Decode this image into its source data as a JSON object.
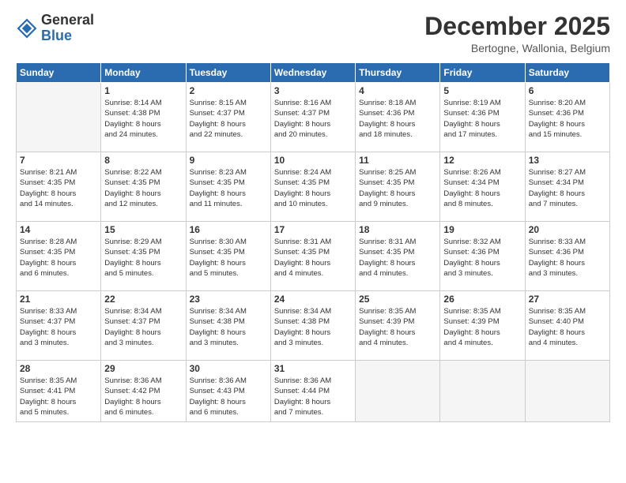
{
  "logo": {
    "general": "General",
    "blue": "Blue"
  },
  "title": "December 2025",
  "location": "Bertogne, Wallonia, Belgium",
  "days_of_week": [
    "Sunday",
    "Monday",
    "Tuesday",
    "Wednesday",
    "Thursday",
    "Friday",
    "Saturday"
  ],
  "weeks": [
    [
      {
        "day": "",
        "detail": ""
      },
      {
        "day": "1",
        "detail": "Sunrise: 8:14 AM\nSunset: 4:38 PM\nDaylight: 8 hours\nand 24 minutes."
      },
      {
        "day": "2",
        "detail": "Sunrise: 8:15 AM\nSunset: 4:37 PM\nDaylight: 8 hours\nand 22 minutes."
      },
      {
        "day": "3",
        "detail": "Sunrise: 8:16 AM\nSunset: 4:37 PM\nDaylight: 8 hours\nand 20 minutes."
      },
      {
        "day": "4",
        "detail": "Sunrise: 8:18 AM\nSunset: 4:36 PM\nDaylight: 8 hours\nand 18 minutes."
      },
      {
        "day": "5",
        "detail": "Sunrise: 8:19 AM\nSunset: 4:36 PM\nDaylight: 8 hours\nand 17 minutes."
      },
      {
        "day": "6",
        "detail": "Sunrise: 8:20 AM\nSunset: 4:36 PM\nDaylight: 8 hours\nand 15 minutes."
      }
    ],
    [
      {
        "day": "7",
        "detail": "Sunrise: 8:21 AM\nSunset: 4:35 PM\nDaylight: 8 hours\nand 14 minutes."
      },
      {
        "day": "8",
        "detail": "Sunrise: 8:22 AM\nSunset: 4:35 PM\nDaylight: 8 hours\nand 12 minutes."
      },
      {
        "day": "9",
        "detail": "Sunrise: 8:23 AM\nSunset: 4:35 PM\nDaylight: 8 hours\nand 11 minutes."
      },
      {
        "day": "10",
        "detail": "Sunrise: 8:24 AM\nSunset: 4:35 PM\nDaylight: 8 hours\nand 10 minutes."
      },
      {
        "day": "11",
        "detail": "Sunrise: 8:25 AM\nSunset: 4:35 PM\nDaylight: 8 hours\nand 9 minutes."
      },
      {
        "day": "12",
        "detail": "Sunrise: 8:26 AM\nSunset: 4:34 PM\nDaylight: 8 hours\nand 8 minutes."
      },
      {
        "day": "13",
        "detail": "Sunrise: 8:27 AM\nSunset: 4:34 PM\nDaylight: 8 hours\nand 7 minutes."
      }
    ],
    [
      {
        "day": "14",
        "detail": "Sunrise: 8:28 AM\nSunset: 4:35 PM\nDaylight: 8 hours\nand 6 minutes."
      },
      {
        "day": "15",
        "detail": "Sunrise: 8:29 AM\nSunset: 4:35 PM\nDaylight: 8 hours\nand 5 minutes."
      },
      {
        "day": "16",
        "detail": "Sunrise: 8:30 AM\nSunset: 4:35 PM\nDaylight: 8 hours\nand 5 minutes."
      },
      {
        "day": "17",
        "detail": "Sunrise: 8:31 AM\nSunset: 4:35 PM\nDaylight: 8 hours\nand 4 minutes."
      },
      {
        "day": "18",
        "detail": "Sunrise: 8:31 AM\nSunset: 4:35 PM\nDaylight: 8 hours\nand 4 minutes."
      },
      {
        "day": "19",
        "detail": "Sunrise: 8:32 AM\nSunset: 4:36 PM\nDaylight: 8 hours\nand 3 minutes."
      },
      {
        "day": "20",
        "detail": "Sunrise: 8:33 AM\nSunset: 4:36 PM\nDaylight: 8 hours\nand 3 minutes."
      }
    ],
    [
      {
        "day": "21",
        "detail": "Sunrise: 8:33 AM\nSunset: 4:37 PM\nDaylight: 8 hours\nand 3 minutes."
      },
      {
        "day": "22",
        "detail": "Sunrise: 8:34 AM\nSunset: 4:37 PM\nDaylight: 8 hours\nand 3 minutes."
      },
      {
        "day": "23",
        "detail": "Sunrise: 8:34 AM\nSunset: 4:38 PM\nDaylight: 8 hours\nand 3 minutes."
      },
      {
        "day": "24",
        "detail": "Sunrise: 8:34 AM\nSunset: 4:38 PM\nDaylight: 8 hours\nand 3 minutes."
      },
      {
        "day": "25",
        "detail": "Sunrise: 8:35 AM\nSunset: 4:39 PM\nDaylight: 8 hours\nand 4 minutes."
      },
      {
        "day": "26",
        "detail": "Sunrise: 8:35 AM\nSunset: 4:39 PM\nDaylight: 8 hours\nand 4 minutes."
      },
      {
        "day": "27",
        "detail": "Sunrise: 8:35 AM\nSunset: 4:40 PM\nDaylight: 8 hours\nand 4 minutes."
      }
    ],
    [
      {
        "day": "28",
        "detail": "Sunrise: 8:35 AM\nSunset: 4:41 PM\nDaylight: 8 hours\nand 5 minutes."
      },
      {
        "day": "29",
        "detail": "Sunrise: 8:36 AM\nSunset: 4:42 PM\nDaylight: 8 hours\nand 6 minutes."
      },
      {
        "day": "30",
        "detail": "Sunrise: 8:36 AM\nSunset: 4:43 PM\nDaylight: 8 hours\nand 6 minutes."
      },
      {
        "day": "31",
        "detail": "Sunrise: 8:36 AM\nSunset: 4:44 PM\nDaylight: 8 hours\nand 7 minutes."
      },
      {
        "day": "",
        "detail": ""
      },
      {
        "day": "",
        "detail": ""
      },
      {
        "day": "",
        "detail": ""
      }
    ]
  ]
}
